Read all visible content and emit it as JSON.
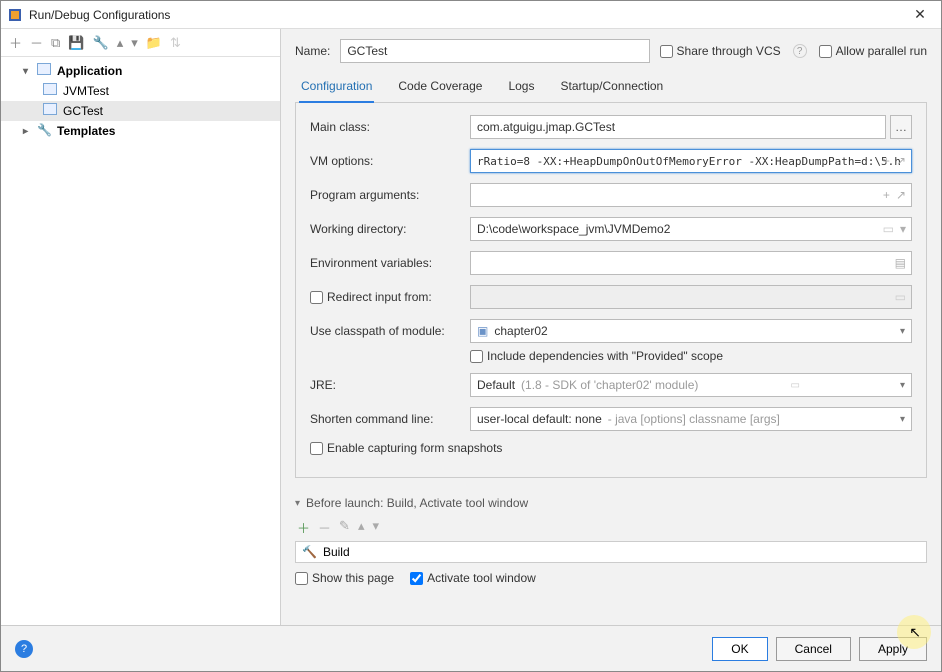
{
  "window": {
    "title": "Run/Debug Configurations"
  },
  "tree": {
    "application": "Application",
    "jvmtest": "JVMTest",
    "gctest": "GCTest",
    "templates": "Templates"
  },
  "name": {
    "label": "Name:",
    "value": "GCTest"
  },
  "share": {
    "label": "Share through VCS"
  },
  "parallel": {
    "label": "Allow parallel run"
  },
  "tabs": {
    "configuration": "Configuration",
    "coverage": "Code Coverage",
    "logs": "Logs",
    "startup": "Startup/Connection"
  },
  "fields": {
    "mainclass": {
      "label": "Main class:",
      "value": "com.atguigu.jmap.GCTest"
    },
    "vmoptions": {
      "label": "VM options:",
      "value": "rRatio=8 -XX:+HeapDumpOnOutOfMemoryError -XX:HeapDumpPath=d:\\5.h"
    },
    "progargs": {
      "label": "Program arguments:",
      "value": ""
    },
    "workdir": {
      "label": "Working directory:",
      "value": "D:\\code\\workspace_jvm\\JVMDemo2"
    },
    "envvars": {
      "label": "Environment variables:",
      "value": ""
    },
    "redirect": {
      "label": "Redirect input from:"
    },
    "classpath": {
      "label": "Use classpath of module:",
      "value": "chapter02"
    },
    "includedeps": {
      "label": "Include dependencies with \"Provided\" scope"
    },
    "jre": {
      "label": "JRE:",
      "value": "Default",
      "hint": "(1.8 - SDK of 'chapter02' module)"
    },
    "shorten": {
      "label": "Shorten command line:",
      "value": "user-local default: none",
      "hint": " - java [options] classname [args]"
    },
    "snapshots": {
      "label": "Enable capturing form snapshots"
    }
  },
  "beforeLaunch": {
    "header": "Before launch: Build, Activate tool window",
    "item": "Build",
    "showpage": "Show this page",
    "activate": "Activate tool window"
  },
  "buttons": {
    "ok": "OK",
    "cancel": "Cancel",
    "apply": "Apply"
  }
}
